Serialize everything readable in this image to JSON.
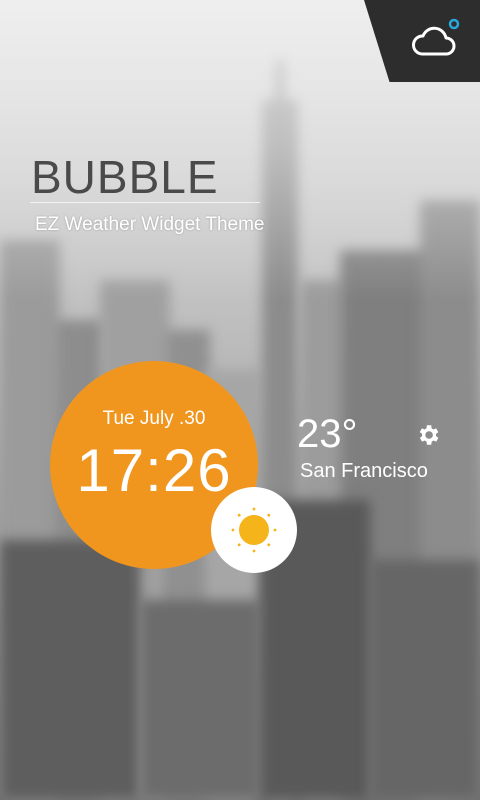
{
  "brand": {
    "title": "BUBBLE",
    "subtitle": "EZ Weather Widget Theme"
  },
  "widget": {
    "date": "Tue July .30",
    "time": "17:26",
    "temperature": "23°",
    "city": "San Francisco",
    "condition_icon": "sun-icon",
    "accent_color": "#f0961e"
  },
  "corner": {
    "icon": "cloud-icon",
    "dot_color": "#29a8e0"
  }
}
